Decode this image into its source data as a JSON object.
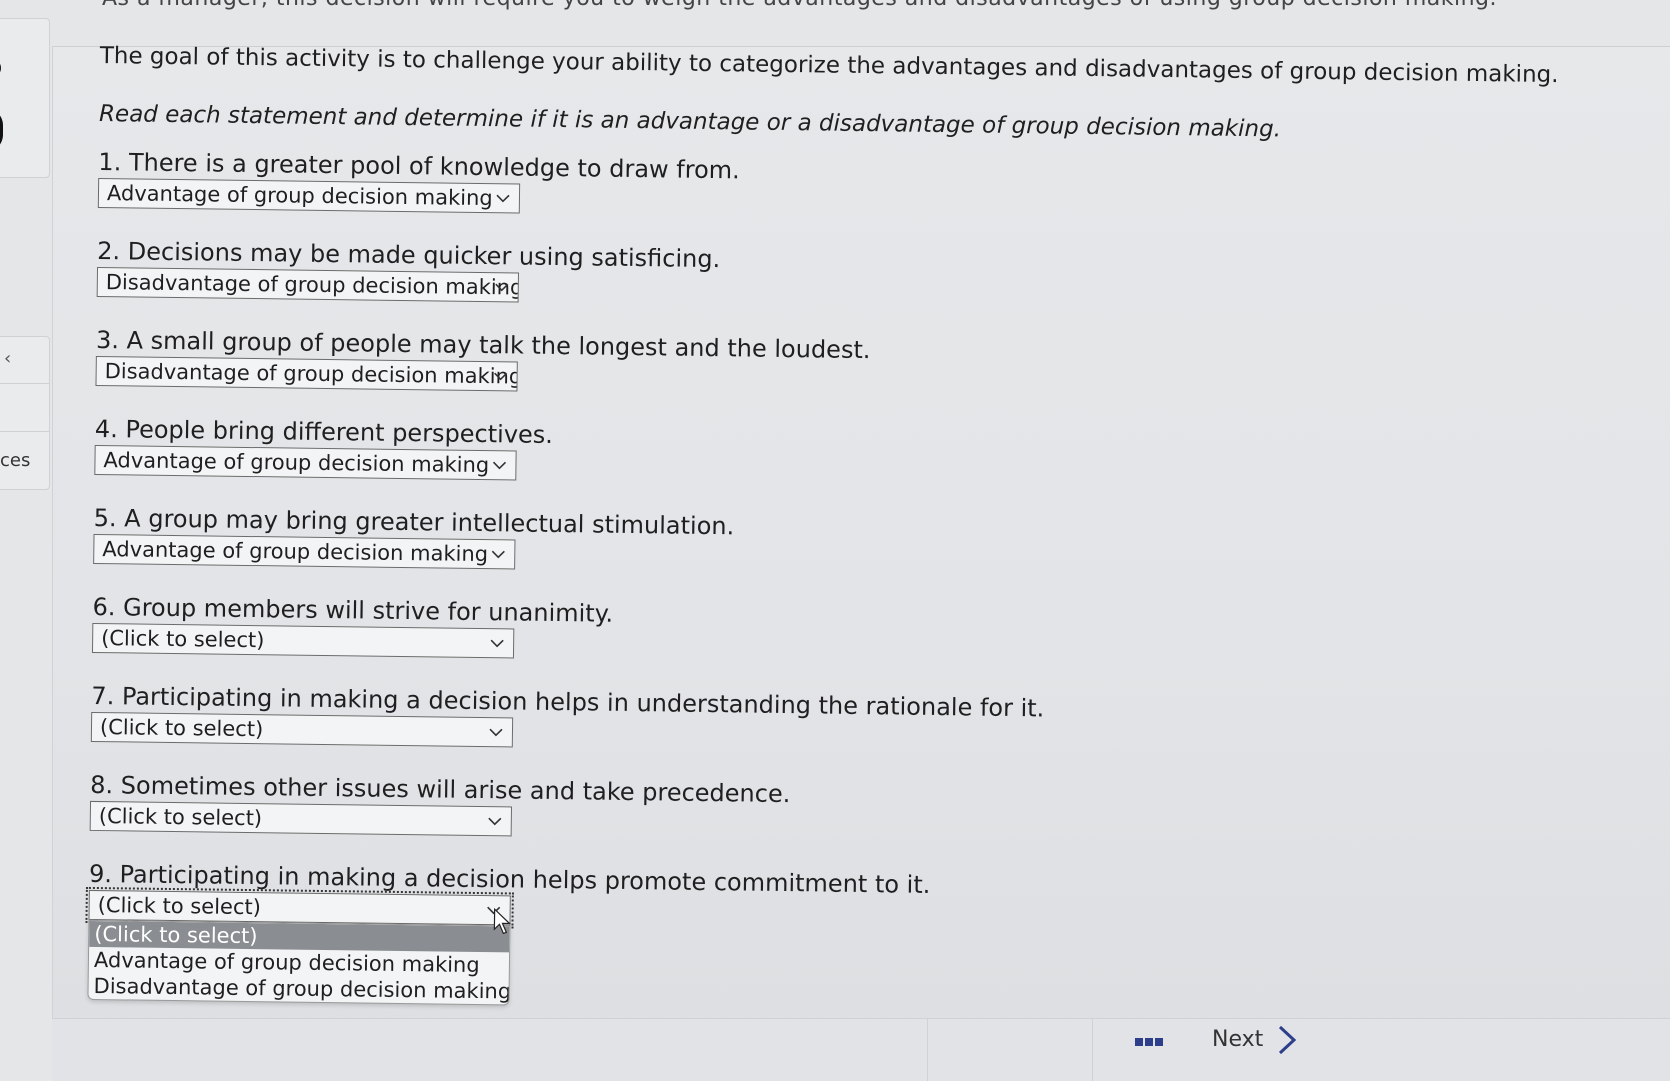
{
  "header": {
    "clipped_text": "As a manager, this decision will require you to weigh the advantages and disadvantages of using group decision making."
  },
  "sidebar": {
    "partial_label": "ces"
  },
  "activity": {
    "intro": "The goal of this activity is to challenge your ability to categorize the advantages and disadvantages of group decision making.",
    "instruction": "Read each statement and determine if it is an advantage or a disadvantage of group decision making."
  },
  "dropdown_options": [
    "(Click to select)",
    "Advantage of group decision making",
    "Disadvantage of group decision making"
  ],
  "questions": [
    {
      "text": "1. There is a greater pool of knowledge to draw from.",
      "selected": "Advantage of group decision making"
    },
    {
      "text": "2. Decisions may be made quicker using satisficing.",
      "selected": "Disadvantage of group decision making"
    },
    {
      "text": "3. A small group of people may talk the longest and the loudest.",
      "selected": "Disadvantage of group decision making"
    },
    {
      "text": "4. People bring different perspectives.",
      "selected": "Advantage of group decision making"
    },
    {
      "text": "5. A group may bring greater intellectual stimulation.",
      "selected": "Advantage of group decision making"
    },
    {
      "text": "6. Group members will strive for unanimity.",
      "selected": "(Click to select)"
    },
    {
      "text": "7. Participating in making a decision helps in understanding the rationale for it.",
      "selected": "(Click to select)"
    },
    {
      "text": "8. Sometimes other issues will arise and take precedence.",
      "selected": "(Click to select)"
    },
    {
      "text": "9. Participating in making a decision helps promote commitment to it.",
      "selected": "(Click to select)"
    }
  ],
  "footer": {
    "next_label": "Next"
  },
  "colors": {
    "grid_icon": "#2d3f8a",
    "option_highlight": "#8a8d91"
  }
}
